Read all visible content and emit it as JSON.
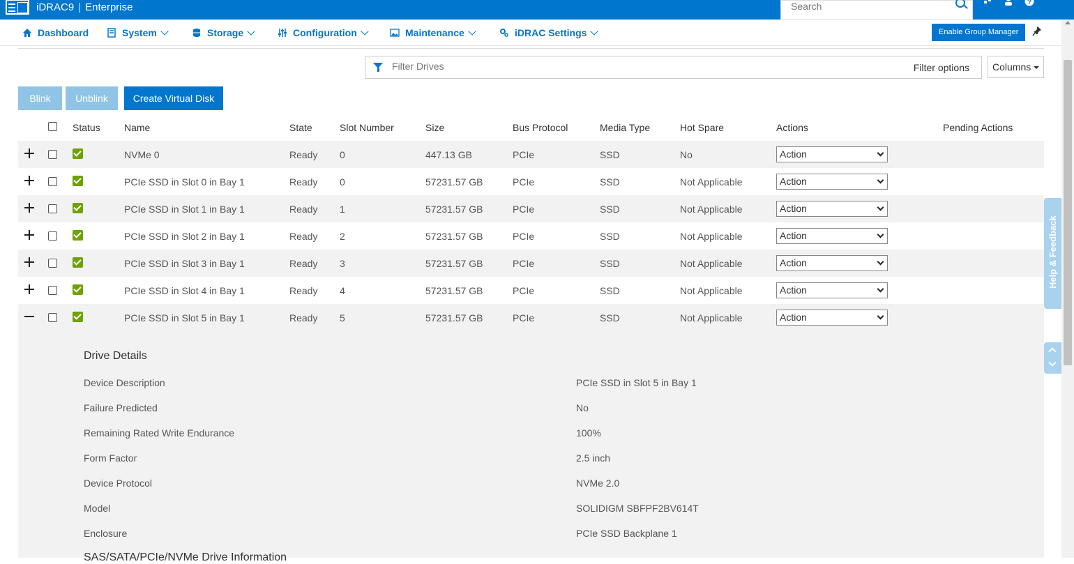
{
  "header": {
    "brand": "iDRAC9",
    "edition": "Enterprise",
    "search_placeholder": "Search"
  },
  "nav": {
    "items": [
      {
        "label": "Dashboard",
        "icon": "home-icon",
        "has_menu": false
      },
      {
        "label": "System",
        "icon": "system-icon",
        "has_menu": true
      },
      {
        "label": "Storage",
        "icon": "storage-icon",
        "has_menu": true
      },
      {
        "label": "Configuration",
        "icon": "sliders-icon",
        "has_menu": true
      },
      {
        "label": "Maintenance",
        "icon": "image-icon",
        "has_menu": true
      },
      {
        "label": "iDRAC Settings",
        "icon": "gears-icon",
        "has_menu": true
      }
    ],
    "group_manager_label": "Enable Group Manager"
  },
  "filter": {
    "placeholder": "Filter Drives",
    "options_label": "Filter options",
    "columns_label": "Columns"
  },
  "toolbar": {
    "blink_label": "Blink",
    "unblink_label": "Unblink",
    "create_vd_label": "Create Virtual Disk"
  },
  "table": {
    "headers": {
      "status": "Status",
      "name": "Name",
      "state": "State",
      "slot": "Slot Number",
      "size": "Size",
      "bus": "Bus Protocol",
      "media": "Media Type",
      "hot_spare": "Hot Spare",
      "actions": "Actions",
      "pending": "Pending Actions"
    },
    "rows": [
      {
        "name": "NVMe 0",
        "state": "Ready",
        "slot": "0",
        "size": "447.13 GB",
        "bus": "PCIe",
        "media": "SSD",
        "hot_spare": "No",
        "action": "Action",
        "expanded": false
      },
      {
        "name": "PCIe SSD in Slot 0 in Bay 1",
        "state": "Ready",
        "slot": "0",
        "size": "57231.57 GB",
        "bus": "PCIe",
        "media": "SSD",
        "hot_spare": "Not Applicable",
        "action": "Action",
        "expanded": false
      },
      {
        "name": "PCIe SSD in Slot 1 in Bay 1",
        "state": "Ready",
        "slot": "1",
        "size": "57231.57 GB",
        "bus": "PCIe",
        "media": "SSD",
        "hot_spare": "Not Applicable",
        "action": "Action",
        "expanded": false
      },
      {
        "name": "PCIe SSD in Slot 2 in Bay 1",
        "state": "Ready",
        "slot": "2",
        "size": "57231.57 GB",
        "bus": "PCIe",
        "media": "SSD",
        "hot_spare": "Not Applicable",
        "action": "Action",
        "expanded": false
      },
      {
        "name": "PCIe SSD in Slot 3 in Bay 1",
        "state": "Ready",
        "slot": "3",
        "size": "57231.57 GB",
        "bus": "PCIe",
        "media": "SSD",
        "hot_spare": "Not Applicable",
        "action": "Action",
        "expanded": false
      },
      {
        "name": "PCIe SSD in Slot 4 in Bay 1",
        "state": "Ready",
        "slot": "4",
        "size": "57231.57 GB",
        "bus": "PCIe",
        "media": "SSD",
        "hot_spare": "Not Applicable",
        "action": "Action",
        "expanded": false
      },
      {
        "name": "PCIe SSD in Slot 5 in Bay 1",
        "state": "Ready",
        "slot": "5",
        "size": "57231.57 GB",
        "bus": "PCIe",
        "media": "SSD",
        "hot_spare": "Not Applicable",
        "action": "Action",
        "expanded": true
      }
    ]
  },
  "details": {
    "title": "Drive Details",
    "items": [
      {
        "label": "Device Description",
        "value": "PCIe SSD in Slot 5 in Bay 1"
      },
      {
        "label": "Failure Predicted",
        "value": "No"
      },
      {
        "label": "Remaining Rated Write Endurance",
        "value": "100%"
      },
      {
        "label": "Form Factor",
        "value": "2.5 inch"
      },
      {
        "label": "Device Protocol",
        "value": "NVMe 2.0"
      },
      {
        "label": "Model",
        "value": "SOLIDIGM SBFPF2BV614T"
      },
      {
        "label": "Enclosure",
        "value": "PCIe SSD Backplane 1"
      }
    ],
    "next_section": "SAS/SATA/PCIe/NVMe Drive Information"
  },
  "side": {
    "help_label": "Help & Feedback"
  },
  "colors": {
    "brand_blue": "#0076ce",
    "status_ok": "#6ea204",
    "disabled_button": "#8fc4e6"
  }
}
